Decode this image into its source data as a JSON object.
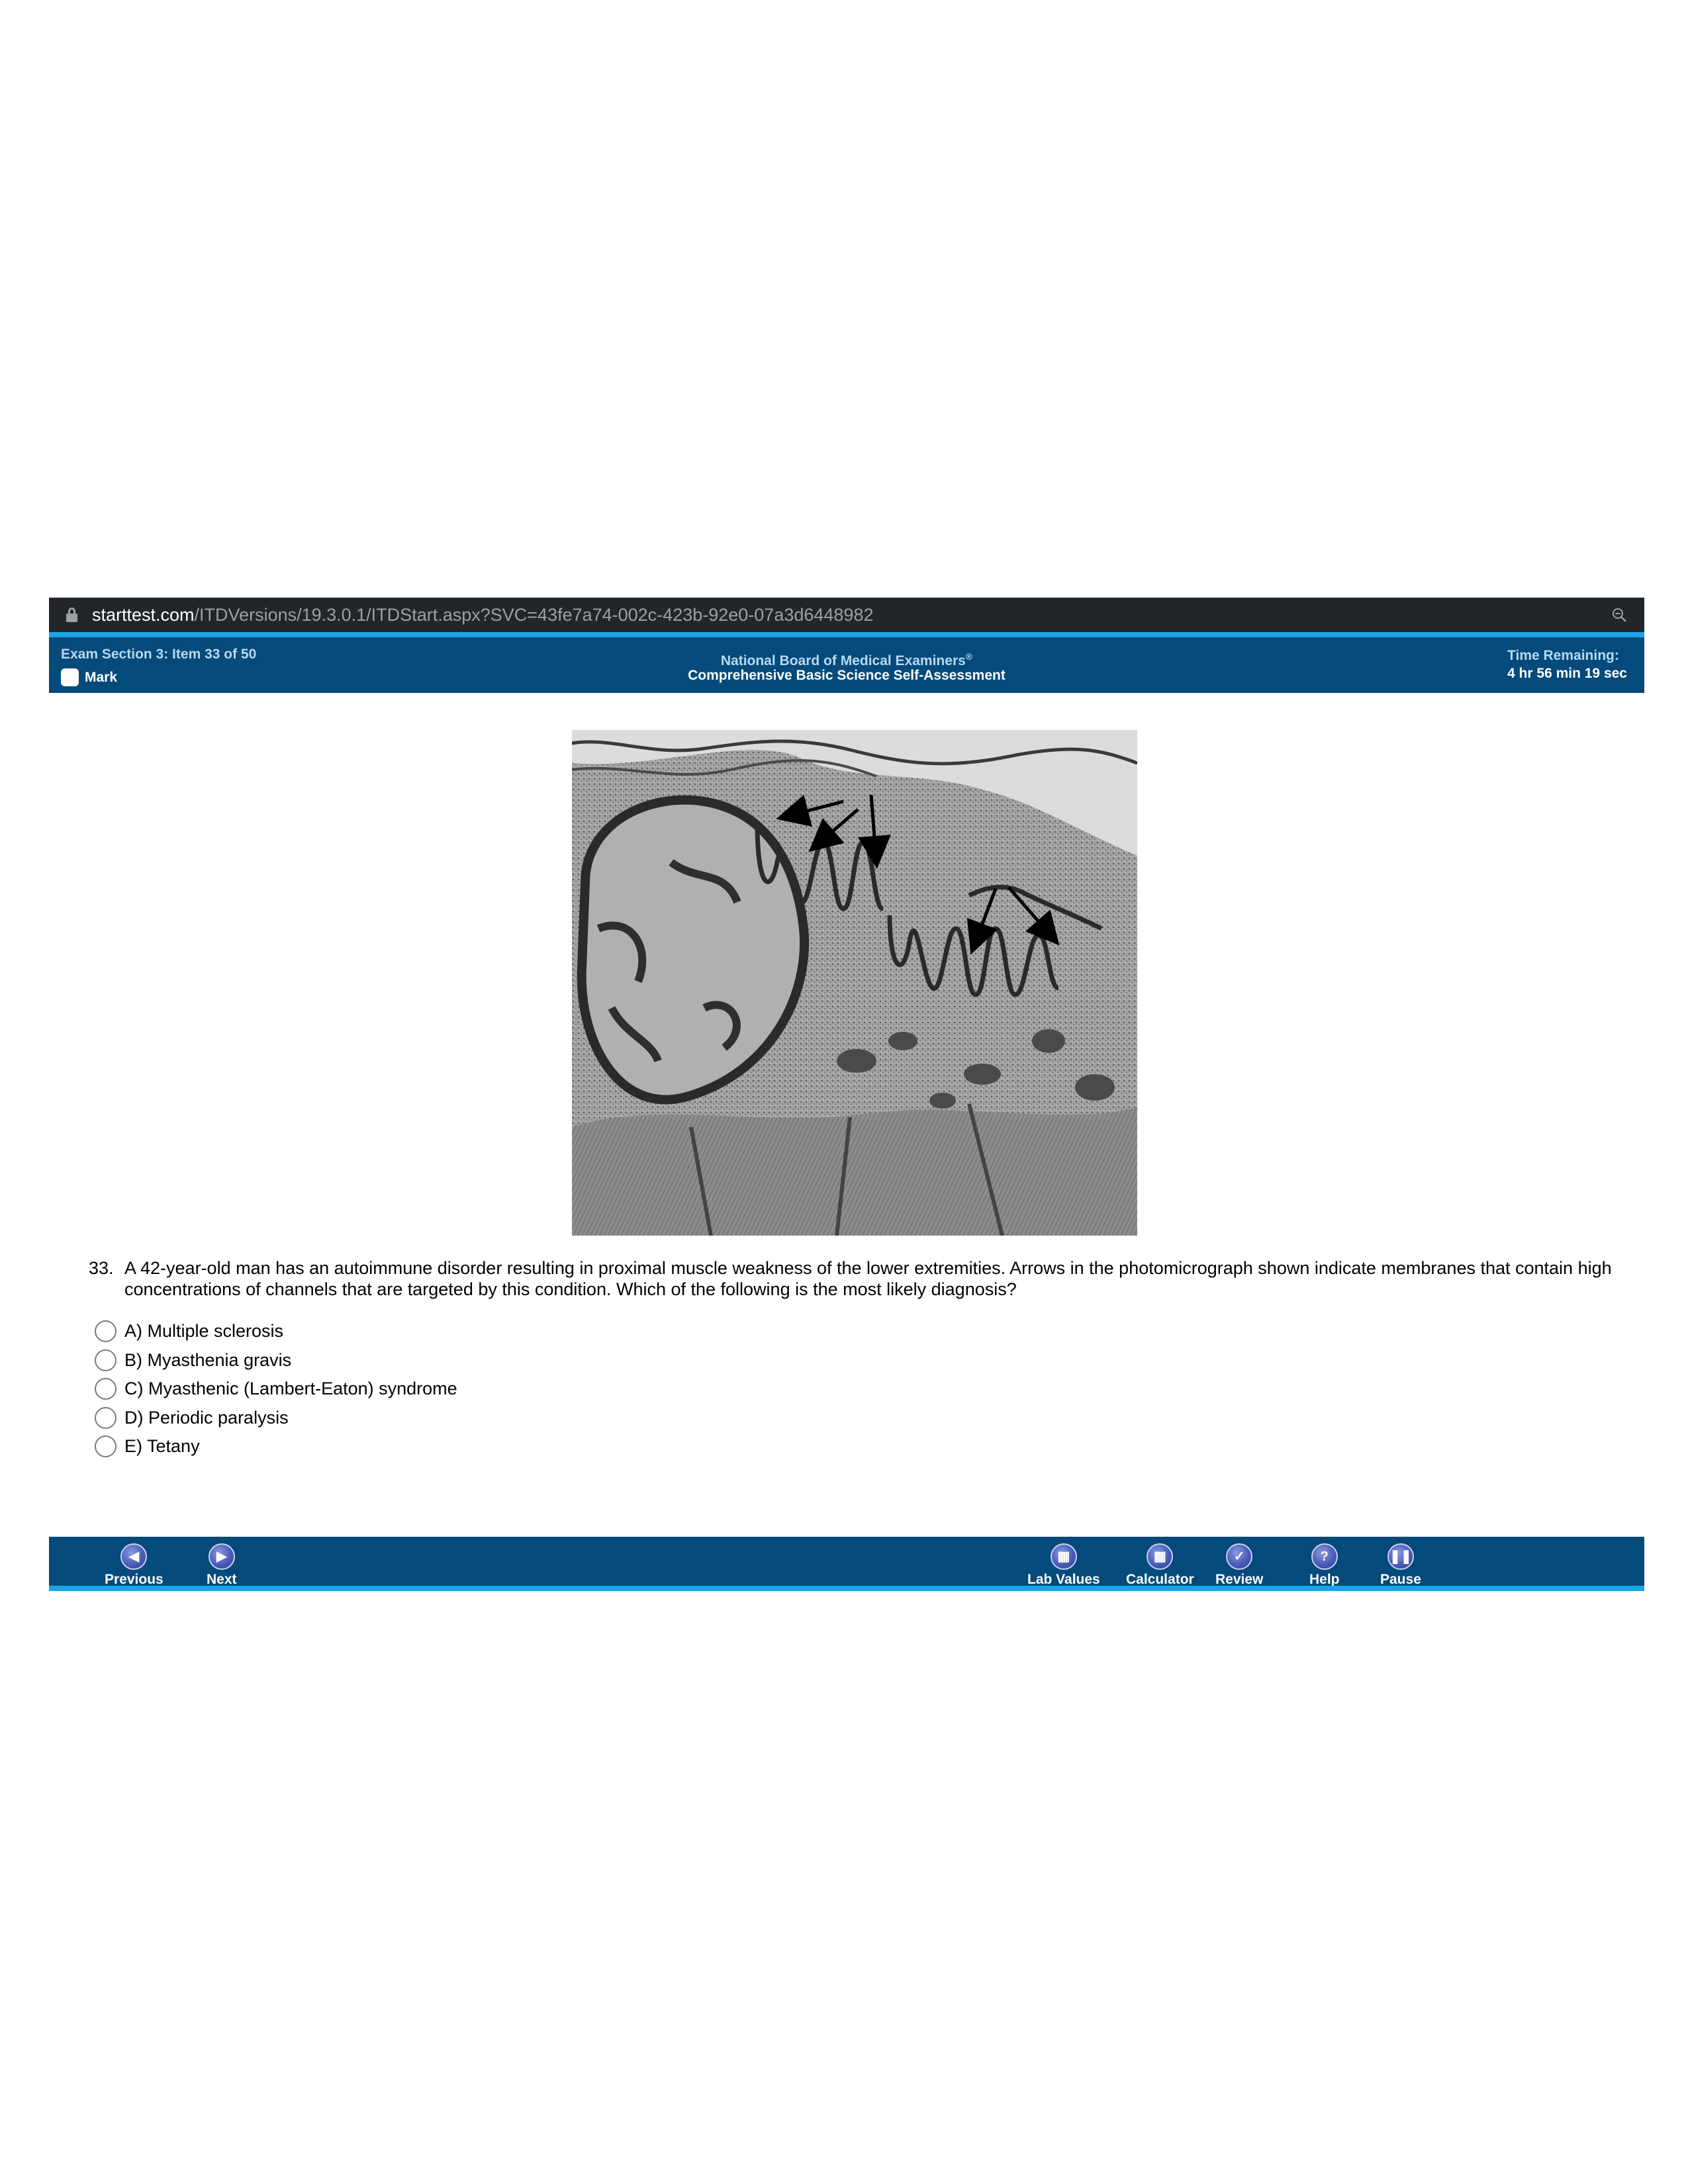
{
  "browser": {
    "url_domain": "starttest.com",
    "url_path": "/ITDVersions/19.3.0.1/ITDStart.aspx?SVC=43fe7a74-002c-423b-92e0-07a3d6448982"
  },
  "header": {
    "item_status": "Exam Section 3: Item 33 of 50",
    "mark_label": "Mark",
    "org_name": "National Board of Medical Examiners",
    "org_mark": "®",
    "exam_name": "Comprehensive Basic Science Self-Assessment",
    "time_label": "Time Remaining:",
    "time_value": "4 hr 56 min 19 sec"
  },
  "question": {
    "number": "33.",
    "text": "A 42-year-old man has an autoimmune disorder resulting in proximal muscle weakness of the lower extremities. Arrows in the photomicrograph shown indicate membranes that contain high concentrations of channels that are targeted by this condition. Which of the following is the most likely diagnosis?",
    "options": [
      {
        "label": "A) Multiple sclerosis"
      },
      {
        "label": "B) Myasthenia gravis"
      },
      {
        "label": "C) Myasthenic (Lambert-Eaton) syndrome"
      },
      {
        "label": "D) Periodic paralysis"
      },
      {
        "label": "E) Tetany"
      }
    ]
  },
  "footer": {
    "previous_label": "Previous",
    "next_label": "Next",
    "lab_values_label": "Lab Values",
    "calculator_label": "Calculator",
    "review_label": "Review",
    "help_label": "Help",
    "pause_label": "Pause"
  },
  "colors": {
    "header_bg": "#044a7a",
    "accent": "#1aa3e8",
    "address_bar_bg": "#232629"
  }
}
